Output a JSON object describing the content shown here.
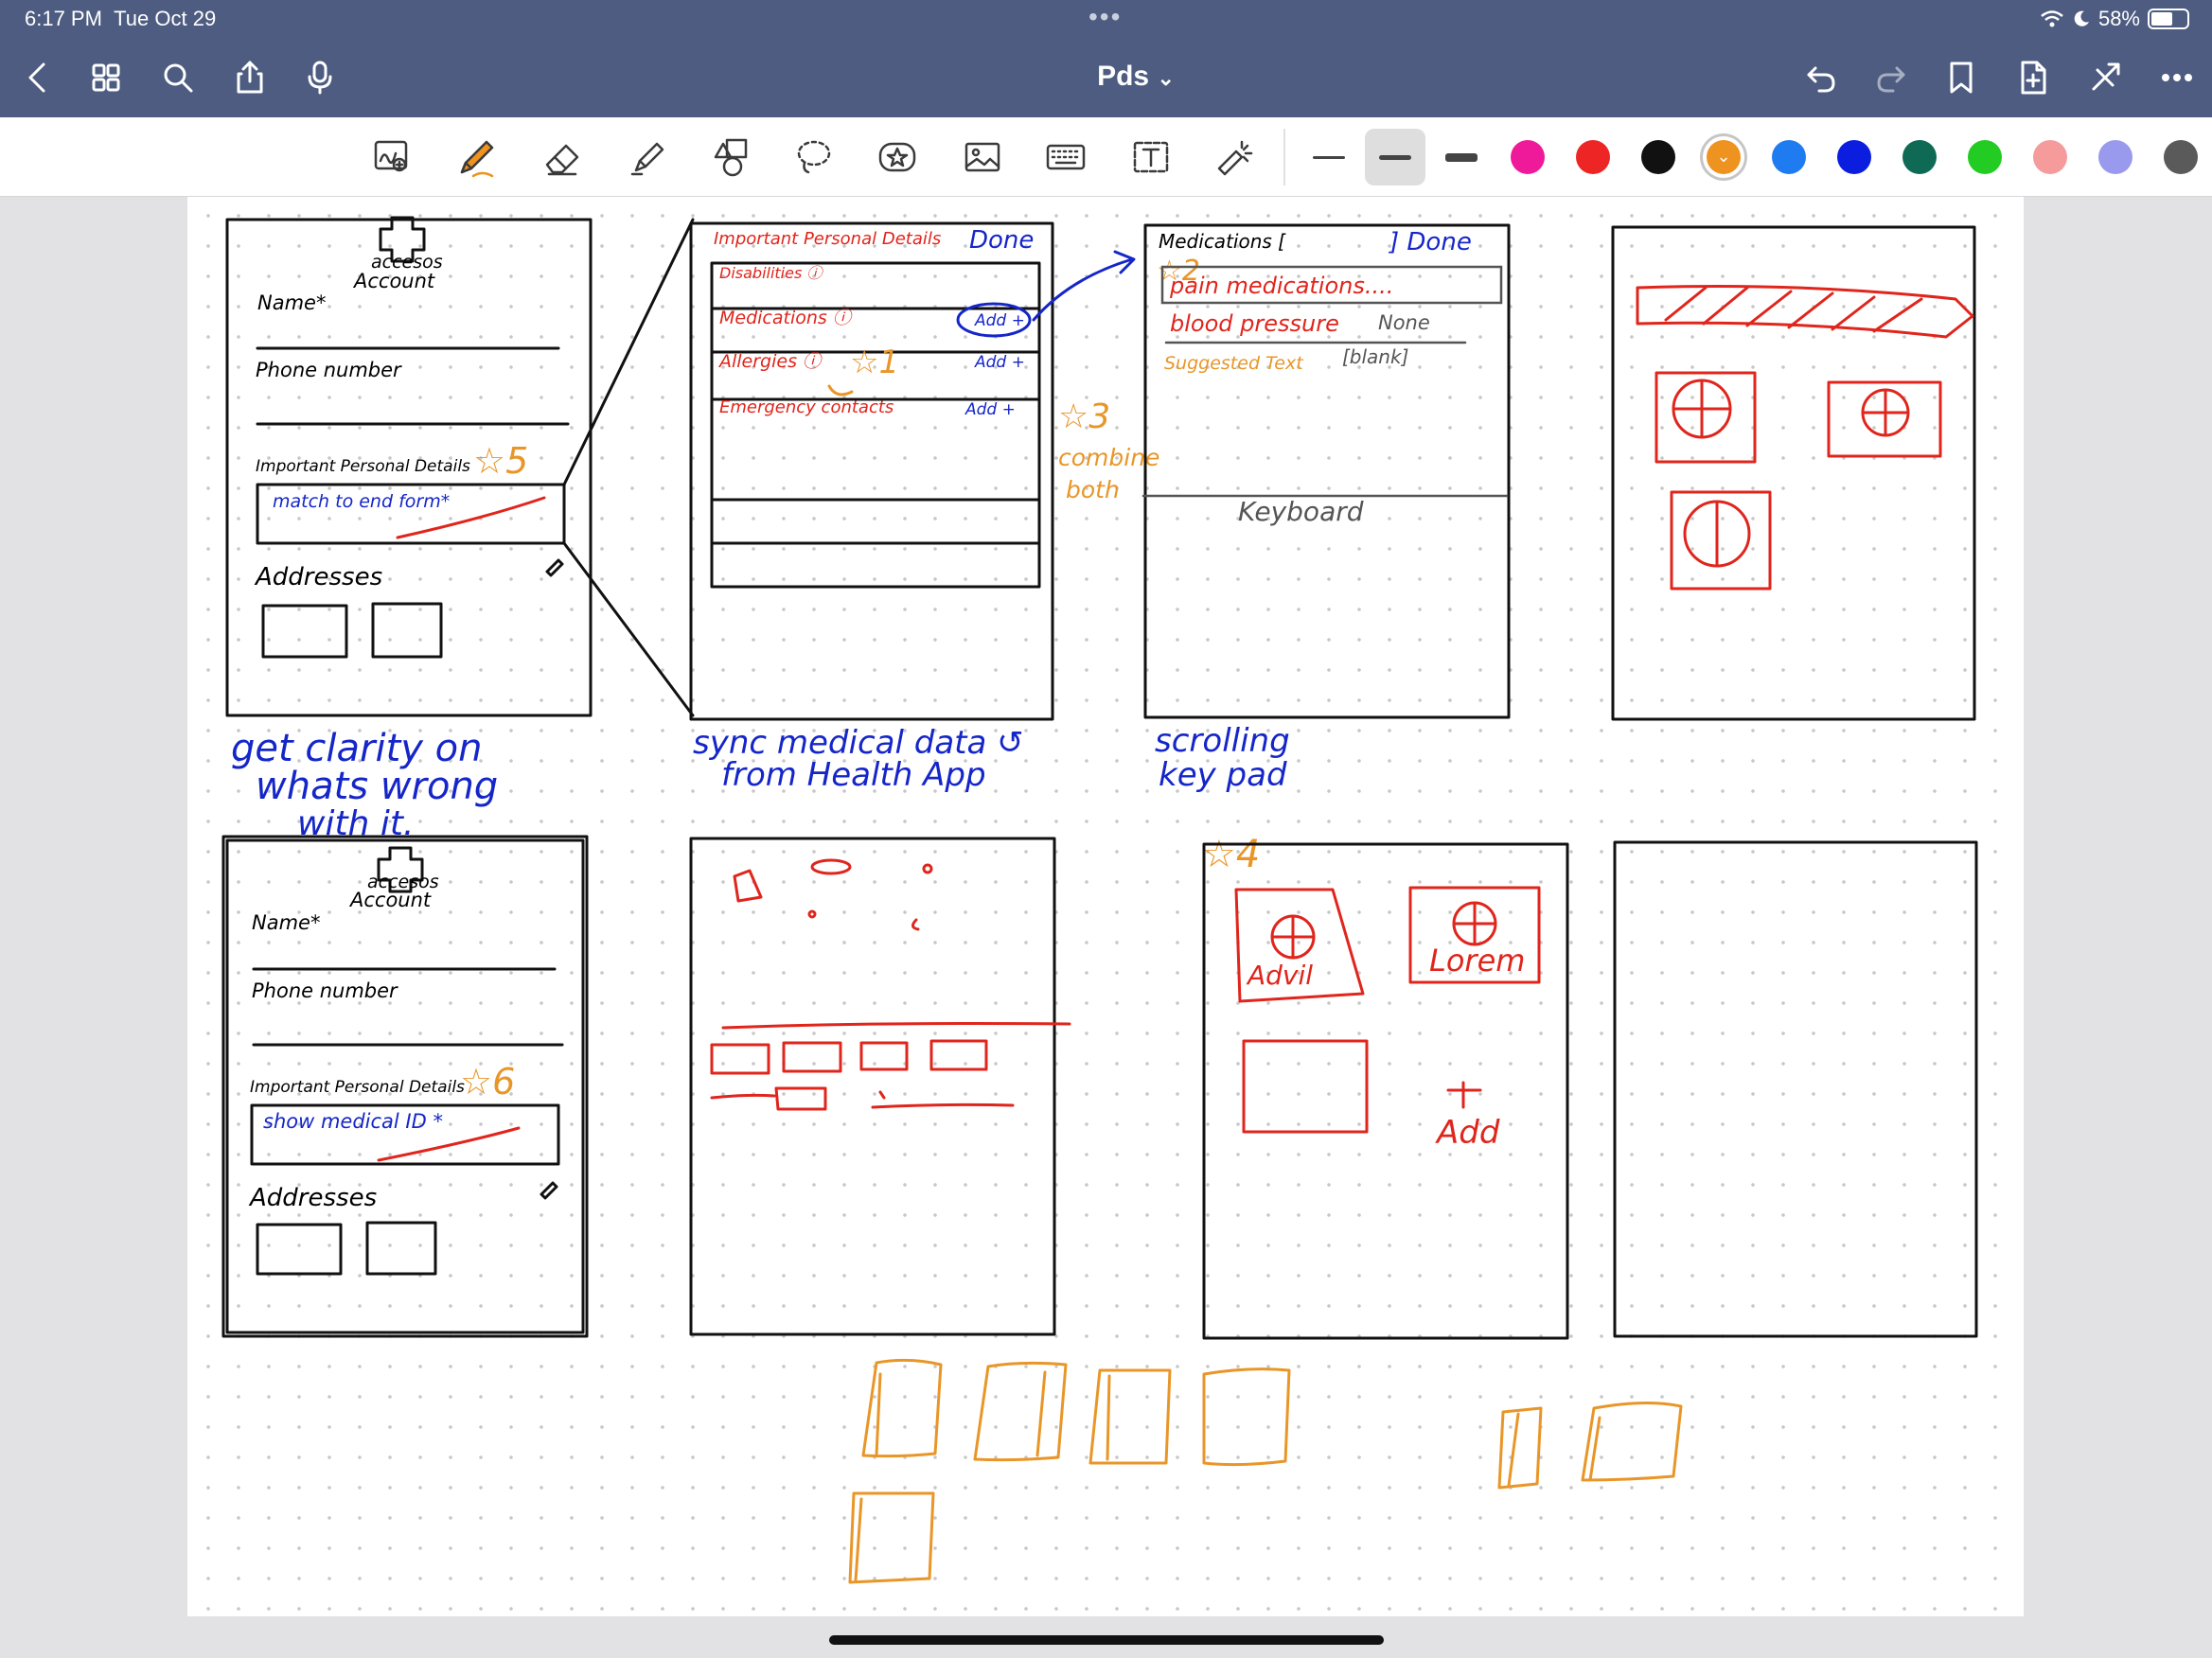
{
  "status_bar": {
    "time": "6:17 PM",
    "date": "Tue Oct 29",
    "battery": "58%",
    "more_dots": "•••"
  },
  "nav": {
    "title": "Pds",
    "title_chevron": "⌄"
  },
  "toolbar": {
    "tools": [
      "zoom-window-icon",
      "pen-icon",
      "eraser-icon",
      "highlighter-icon",
      "shapes-icon",
      "lasso-icon",
      "sticker-icon",
      "image-icon",
      "keyboard-icon",
      "text-box-icon",
      "laser-pointer-icon"
    ],
    "selected_tool": "pen-icon",
    "line_widths": [
      "thin",
      "medium",
      "thick"
    ],
    "selected_width": "medium",
    "colors": [
      "#ef1a9a",
      "#ee2525",
      "#111111",
      "#ee9220",
      "#1e7cf0",
      "#0b1ee0",
      "#0f6a55",
      "#22cc22",
      "#f59b9b",
      "#9999ee",
      "#5a5a5a"
    ],
    "selected_color": "#ee9220"
  },
  "page": {
    "f1": {
      "logo": "accesos",
      "account": "Account",
      "name": "Name*",
      "phone": "Phone number",
      "ipd": "Important Personal Details",
      "star": "☆5",
      "field": "match to end form*",
      "addresses": "Addresses"
    },
    "f2": {
      "ipd": "Important Personal Details",
      "done": "Done",
      "disabilities": "Disabilities ⓘ",
      "medications": "Medications ⓘ",
      "add": "Add +",
      "allergies": "Allergies ⓘ",
      "star1": "☆1",
      "emergency": "Emergency contacts"
    },
    "f3": {
      "meds": "Medications [",
      "done": "] Done",
      "star2": "☆2",
      "pain": "pain medications....",
      "bp": "blood pressure",
      "none": "None",
      "suggested": "Suggested Text",
      "blank": "[blank]",
      "keyboard": "Keyboard"
    },
    "note3": {
      "star": "☆3",
      "l1": "combine",
      "l2": "both"
    },
    "cap1": {
      "l1": "get clarity on",
      "l2": "whats wrong",
      "l3": "with it."
    },
    "cap2": {
      "l1": "sync medical data ↺",
      "l2": "from Health App"
    },
    "cap3": {
      "l1": "scrolling",
      "l2": "key pad"
    },
    "f5": {
      "logo": "accesos",
      "account": "Account",
      "name": "Name*",
      "phone": "Phone number",
      "ipd": "Important Personal Details",
      "star": "☆6",
      "field": "show medical ID *",
      "addresses": "Addresses"
    },
    "f7": {
      "star": "☆4",
      "advil": "Advil",
      "lorem": "Lorem",
      "add": "Add"
    }
  }
}
